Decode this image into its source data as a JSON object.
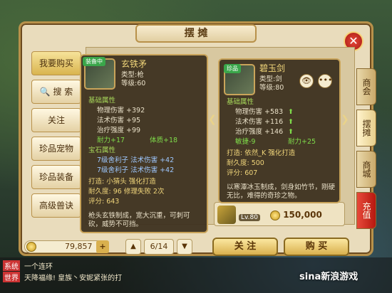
{
  "window": {
    "title": "摆 摊",
    "close": "✕"
  },
  "left_tabs": [
    {
      "label": "我要购买",
      "selected": true
    },
    {
      "label": "搜 索"
    },
    {
      "label": "关注"
    },
    {
      "label": "珍品宠物"
    },
    {
      "label": "珍品装备"
    },
    {
      "label": "高级兽诀"
    }
  ],
  "right_tabs": [
    {
      "label": "商会"
    },
    {
      "label": "摆摊",
      "selected": true
    },
    {
      "label": "商城"
    },
    {
      "label": "充值",
      "red": true
    }
  ],
  "item_left": {
    "ribbon": "装备中",
    "name": "玄铁矛",
    "type": "类型:枪",
    "level": "等级:60",
    "section_base": "基础属性",
    "base": [
      "物理伤害 +392",
      "法术伤害 +95",
      "治疗强度 +99"
    ],
    "durability": "耐力+17",
    "physique": "体质+18",
    "section_gem": "宝石属性",
    "gems": [
      "7级舍利子 法术伤害 +42",
      "7级舍利子 法术伤害 +42"
    ],
    "forge": "打造: 小猜头 强化打造",
    "durab": "耐久度: 96 修理失败 2次",
    "score": "评分: 643",
    "desc": "枪头玄铁制成，宽大沉重，可刺可砍，威势不可挡。"
  },
  "item_right": {
    "ribbon": "珍品",
    "name": "碧玉剑",
    "type": "类型:剑",
    "level": "等级:80",
    "section_base": "基础属性",
    "base": [
      "物理伤害 +583",
      "法术伤害 +116",
      "治疗强度 +146"
    ],
    "agility": "敏捷-9",
    "endurance": "耐力+25",
    "forge": "打造: 依然_K 强化打造",
    "durab": "耐久度: 500",
    "score": "评分: 607",
    "desc": "以寒潭冰玉制成，剑身如竹节，刚硬无比，难得的奇珍之物。",
    "price": "150,000",
    "lv": "Lv.80"
  },
  "bottom": {
    "money": "79,857",
    "page": "6/14",
    "follow": "关 注",
    "buy": "购 买"
  },
  "chat": {
    "line1_tag": "系统",
    "line1": "一个连环",
    "line2_tag": "世界",
    "line2": "天降福缘! 皇族丶安妮紧张的打"
  },
  "watermark": "sina新浪游戏"
}
